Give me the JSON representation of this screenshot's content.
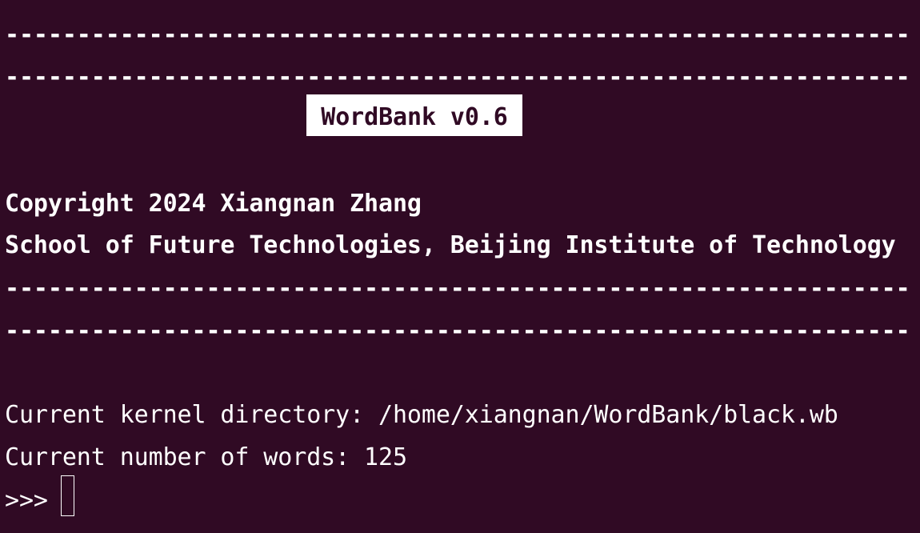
{
  "terminal": {
    "rule_line_1": "---------------------------------------------------------------",
    "rule_line_2": "---------------------------------------------------------------",
    "title": "WordBank v0.6",
    "copyright": "Copyright 2024 Xiangnan Zhang",
    "affiliation": "School of Future Technologies, Beijing Institute of Technology",
    "rule_line_3": "---------------------------------------------------------------",
    "rule_line_4": "---------------------------------------------------------------",
    "kernel_directory": "Current kernel directory: /home/xiangnan/WordBank/black.wb",
    "word_count": "Current number of words: 125",
    "prompt": ">>>",
    "input_value": ""
  },
  "colors": {
    "background": "#300a24",
    "foreground": "#ffffff"
  }
}
